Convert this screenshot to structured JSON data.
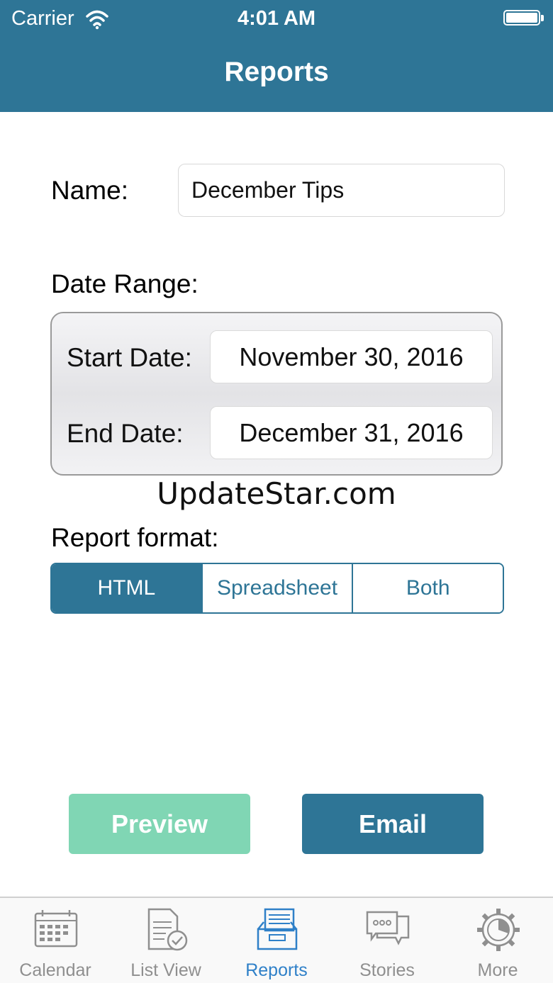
{
  "status_bar": {
    "carrier": "Carrier",
    "time": "4:01 AM"
  },
  "nav": {
    "title": "Reports"
  },
  "form": {
    "name_label": "Name:",
    "name_value": "December Tips",
    "date_range_label": "Date Range:",
    "start_label": "Start Date:",
    "start_value": "November 30, 2016",
    "end_label": "End Date:",
    "end_value": "December 31, 2016",
    "format_label": "Report format:",
    "formats": [
      "HTML",
      "Spreadsheet",
      "Both"
    ],
    "selected_format": "HTML"
  },
  "watermark": "UpdateStar.com",
  "actions": {
    "preview_label": "Preview",
    "email_label": "Email"
  },
  "tabs": [
    {
      "label": "Calendar",
      "icon": "calendar-icon"
    },
    {
      "label": "List View",
      "icon": "list-view-icon"
    },
    {
      "label": "Reports",
      "icon": "reports-icon",
      "active": true
    },
    {
      "label": "Stories",
      "icon": "stories-icon"
    },
    {
      "label": "More",
      "icon": "gear-icon"
    }
  ],
  "colors": {
    "accent": "#2e7596",
    "preview": "#80d6b4",
    "active_tab": "#2f80c8",
    "inactive_tab": "#8f8f8f"
  }
}
